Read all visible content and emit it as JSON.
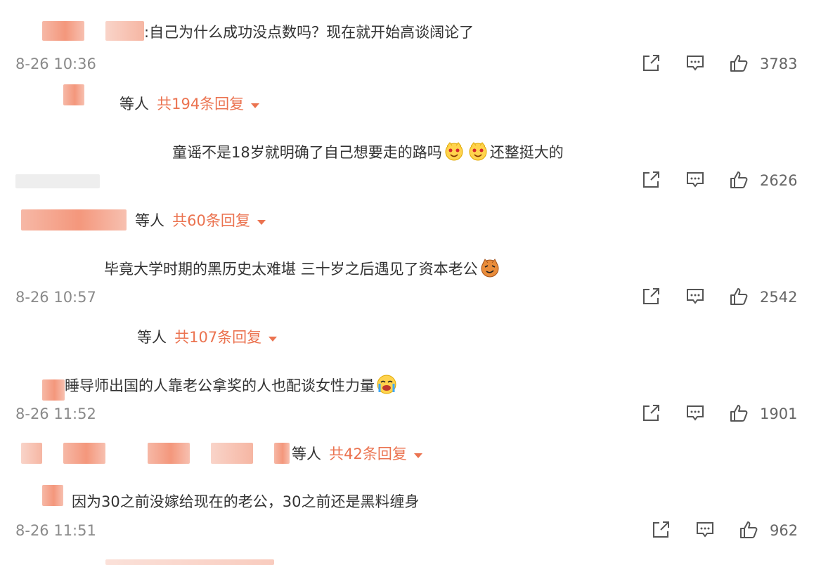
{
  "comments": [
    {
      "text": ":自己为什么成功没点数吗？现在就开始高谈阔论了",
      "time": "8-26 10:36",
      "likes": "3783",
      "reply_by": "等人",
      "reply_count": "共194条回复"
    },
    {
      "text_before": "童谣不是18岁就明确了自己想要走的路吗",
      "text_after": "还整挺大的",
      "likes": "2626",
      "reply_by": "等人",
      "reply_count": "共60条回复"
    },
    {
      "text": "毕竟大学时期的黑历史太难堪 三十岁之后遇见了资本老公",
      "time": "8-26 10:57",
      "likes": "2542",
      "reply_by": "等人",
      "reply_count": "共107条回复"
    },
    {
      "text": "睡导师出国的人靠老公拿奖的人也配谈女性力量",
      "time": "8-26 11:52",
      "likes": "1901",
      "reply_by": "等人",
      "reply_count": "共42条回复"
    },
    {
      "text": "因为30之前没嫁给现在的老公，30之前还是黑料缠身",
      "time": "8-26 11:51",
      "likes": "962"
    }
  ],
  "icons": {
    "share": "share-icon",
    "comment": "comment-icon",
    "like": "thumbs-up-icon",
    "caret": "caret-down-icon"
  },
  "colors": {
    "accent": "#eb7350",
    "text": "#333333",
    "meta": "#8a8a8a"
  }
}
